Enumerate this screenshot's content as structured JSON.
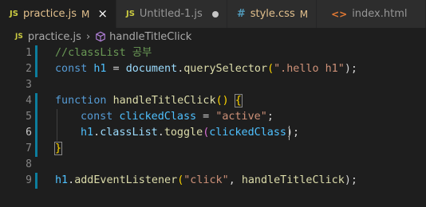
{
  "tabs": [
    {
      "icon": "JS",
      "label": "practice.js",
      "badge": "M",
      "state": "close",
      "active": true
    },
    {
      "icon": "JS",
      "label": "Untitled-1.js",
      "badge": "",
      "state": "dot",
      "active": false
    },
    {
      "icon": "#",
      "label": "style.css",
      "badge": "M",
      "state": "",
      "active": false
    },
    {
      "icon": "<>",
      "label": "index.html",
      "badge": "",
      "state": "",
      "active": false
    }
  ],
  "breadcrumb": {
    "file_icon": "JS",
    "file": "practice.js",
    "separator": "›",
    "symbol": "handleTitleClick"
  },
  "editor": {
    "line_numbers": [
      "1",
      "2",
      "3",
      "4",
      "5",
      "6",
      "7",
      "8",
      "9"
    ],
    "tokens": {
      "l1_comment": "//classList 공부",
      "l2_const": "const",
      "l2_h1": "h1",
      "l2_eq": " = ",
      "l2_document": "document",
      "l2_dot": ".",
      "l2_qs": "querySelector",
      "l2_open": "(",
      "l2_str": "\".hello h1\"",
      "l2_close": ");",
      "l4_function": "function",
      "l4_name": "handleTitleClick",
      "l4_parens": "()",
      "l4_brace": "{",
      "l5_const": "const",
      "l5_var": "clickedClass",
      "l5_eq": " = ",
      "l5_str": "\"active\"",
      "l5_semi": ";",
      "l6_h1": "h1",
      "l6_dot1": ".",
      "l6_classList": "classList",
      "l6_dot2": ".",
      "l6_toggle": "toggle",
      "l6_open": "(",
      "l6_arg": "clickedClass",
      "l6_close": ");",
      "l7_brace": "}",
      "l9_h1": "h1",
      "l9_dot": ".",
      "l9_method": "addEventListener",
      "l9_open": "(",
      "l9_str": "\"click\"",
      "l9_comma": ", ",
      "l9_arg": "handleTitleClick",
      "l9_close": ");"
    }
  },
  "colors": {
    "background": "#1e1e1e",
    "tab_active": "#1e1e1e",
    "tab_inactive": "#2d2d2d",
    "modified": "#e2c08d",
    "keyword": "#569cd6",
    "function": "#dcdcaa",
    "string": "#ce9178",
    "comment": "#6a9955",
    "variable": "#9cdcfe"
  }
}
